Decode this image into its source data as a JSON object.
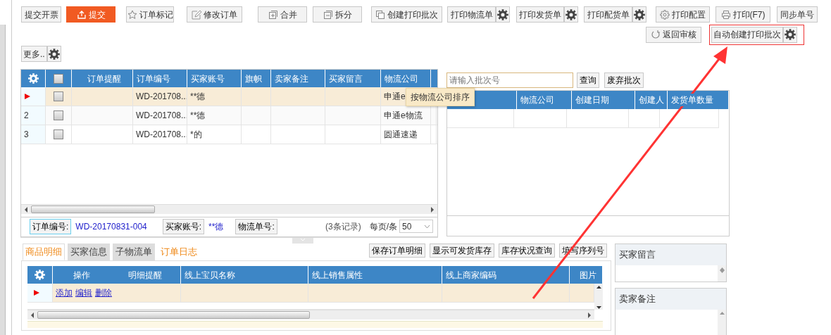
{
  "toolbar": {
    "primary_row": [
      {
        "label": "提交开票",
        "kind": "plain"
      },
      {
        "label": "提交",
        "kind": "accent"
      },
      {
        "label": "订单标记",
        "kind": "plain"
      },
      {
        "label": "修改订单",
        "kind": "plain"
      },
      {
        "label": "合并",
        "kind": "plain"
      },
      {
        "label": "拆分",
        "kind": "plain"
      },
      {
        "label": "创建打印批次",
        "kind": "plain"
      },
      {
        "label": "打印物流单",
        "kind": "split"
      },
      {
        "label": "打印发货单",
        "kind": "split"
      },
      {
        "label": "打印配货单",
        "kind": "split"
      },
      {
        "label": "打印配置",
        "kind": "plain"
      },
      {
        "label": "打印(F7)",
        "kind": "plain"
      },
      {
        "label": "同步单号",
        "kind": "plain"
      }
    ],
    "second_row": [
      {
        "label": "返回审核",
        "kind": "plain",
        "highlighted": false
      },
      {
        "label": "自动创建打印批次",
        "kind": "split",
        "highlighted": true
      }
    ],
    "more": {
      "label": "更多..",
      "kind": "split"
    }
  },
  "order_grid": {
    "select_all": {
      "checked": false
    },
    "columns": [
      "订单提醒",
      "订单编号",
      "买家账号",
      "旗帜",
      "卖家备注",
      "买家留言",
      "物流公司"
    ],
    "rows": [
      {
        "selected": true,
        "checked": false,
        "cells": {
          "order_no": "WD-201708...",
          "buyer": "**德",
          "carrier": "申通e"
        }
      },
      {
        "number": "2",
        "selected": false,
        "checked": false,
        "cells": {
          "order_no": "WD-201708...",
          "buyer": "**德",
          "carrier": "申通e物流"
        }
      },
      {
        "number": "3",
        "selected": false,
        "checked": false,
        "cells": {
          "order_no": "WD-201708...",
          "buyer": "*的",
          "carrier": "圆通速递"
        }
      }
    ],
    "sort_tooltip": "按物流公司排序",
    "footer": {
      "fields": [
        {
          "label": "订单编号:",
          "value": "WD-20170831-004",
          "focused": true
        },
        {
          "label": "买家账号:",
          "value": "**德",
          "focused": false
        },
        {
          "label": "物流单号:",
          "focused": false
        }
      ],
      "records": "(3条记录)",
      "per_page_label": "每页/条",
      "per_page": "50"
    }
  },
  "batch_panel": {
    "search": {
      "placeholder": "请输入批次号"
    },
    "buttons": [
      "查询",
      "废弃批次"
    ],
    "columns": [
      "物流公司",
      "创建日期",
      "创建人",
      "发货单数量"
    ]
  },
  "detail": {
    "tabs": [
      {
        "label": "商品明细",
        "selected": true,
        "highlighted": true
      },
      {
        "label": "买家信息",
        "selected": false,
        "highlighted": false
      },
      {
        "label": "子物流单",
        "selected": false,
        "highlighted": false
      },
      {
        "label": "订单日志",
        "selected": false,
        "highlighted": true
      }
    ],
    "buttons": [
      "保存订单明细",
      "显示可发货库存",
      "库存状况查询",
      "填写序列号"
    ],
    "columns": [
      "操作",
      "明细提醒",
      "线上宝贝名称",
      "线上销售属性",
      "线上商家编码",
      "图片"
    ],
    "rows": [
      {
        "selected": true,
        "actions": [
          "添加",
          "编辑",
          "删除"
        ]
      }
    ]
  },
  "notes": [
    {
      "title": "买家留言"
    },
    {
      "title": "卖家备注"
    }
  ]
}
